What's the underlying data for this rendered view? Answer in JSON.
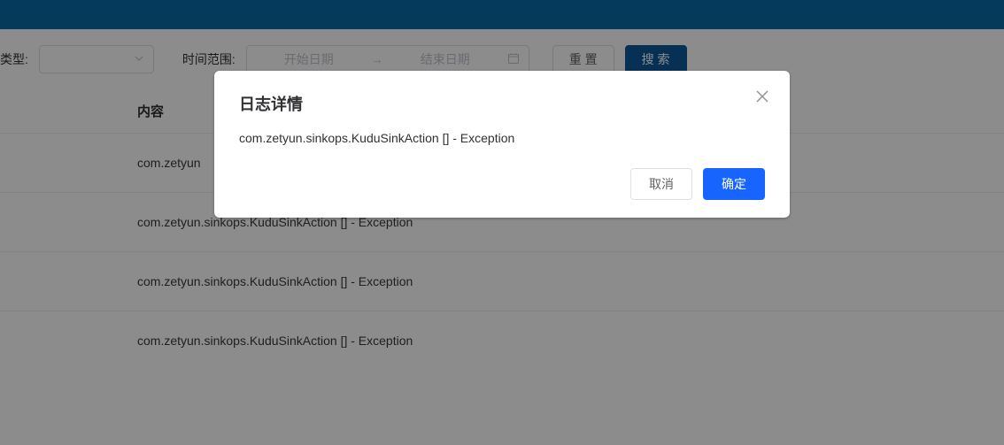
{
  "filter": {
    "type_label": "类型:",
    "time_range_label": "时间范围:",
    "start_placeholder": "开始日期",
    "end_placeholder": "结束日期",
    "reset_label": "重 置",
    "search_label": "搜 索"
  },
  "table": {
    "content_header": "内容",
    "rows": [
      "com.zetyun",
      "com.zetyun.sinkops.KuduSinkAction [] - Exception",
      "com.zetyun.sinkops.KuduSinkAction [] - Exception",
      "com.zetyun.sinkops.KuduSinkAction [] - Exception"
    ]
  },
  "modal": {
    "title": "日志详情",
    "content": "com.zetyun.sinkops.KuduSinkAction [] - Exception",
    "cancel_label": "取消",
    "confirm_label": "确定"
  }
}
